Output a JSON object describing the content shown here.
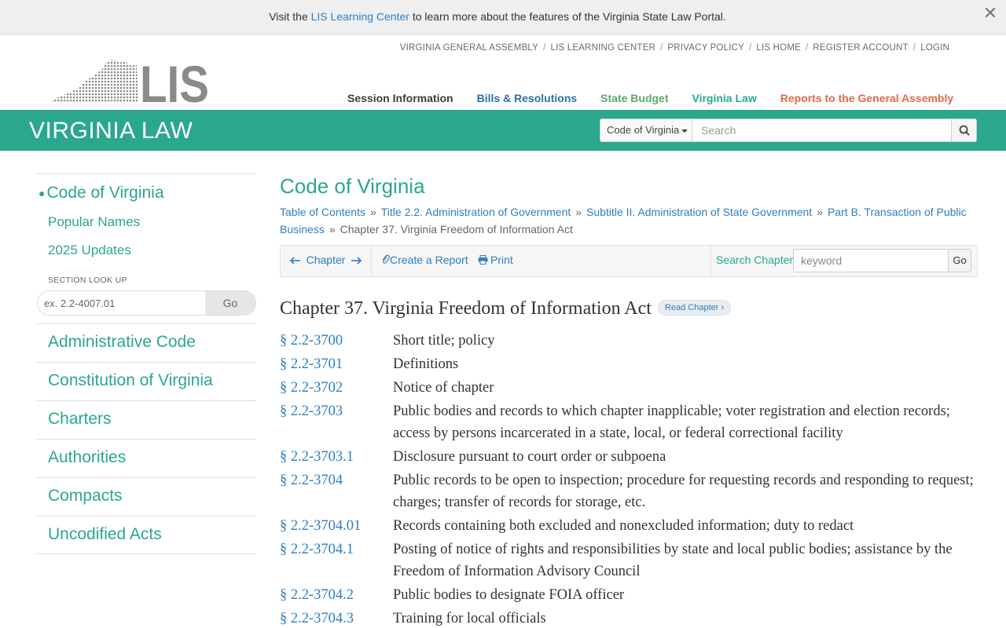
{
  "banner": {
    "prefix": "Visit the ",
    "link": "LIS Learning Center",
    "suffix": " to learn more about the features of the Virginia State Law Portal.",
    "close": "✕"
  },
  "top_links": [
    "VIRGINIA GENERAL ASSEMBLY",
    "LIS LEARNING CENTER",
    "PRIVACY POLICY",
    "LIS HOME",
    "REGISTER ACCOUNT",
    "LOGIN"
  ],
  "logo": {
    "text": "LIS"
  },
  "main_nav": {
    "session": "Session Information",
    "bills": "Bills & Resolutions",
    "budget": "State Budget",
    "law": "Virginia Law",
    "reports": "Reports to the General Assembly"
  },
  "greenbar": {
    "title": "VIRGINIA LAW",
    "select_value": "Code of Virginia",
    "search_placeholder": "Search"
  },
  "sidebar": {
    "current": "Code of Virginia",
    "sub_items": [
      "Popular Names",
      "2025 Updates"
    ],
    "lookup_label": "SECTION LOOK UP",
    "lookup_placeholder": "ex. 2.2-4007.01",
    "lookup_go": "Go",
    "main_items": [
      "Administrative Code",
      "Constitution of Virginia",
      "Charters",
      "Authorities",
      "Compacts",
      "Uncodified Acts"
    ]
  },
  "content": {
    "title": "Code of Virginia",
    "breadcrumb": {
      "links": [
        "Table of Contents",
        "Title 2.2. Administration of Government",
        "Subtitle II. Administration of State Government",
        "Part B. Transaction of Public Business"
      ],
      "current": "Chapter 37. Virginia Freedom of Information Act",
      "separator": "»"
    },
    "toolbar": {
      "chapter": "Chapter",
      "create_report": "Create a Report",
      "print": "Print",
      "search_label": "Search Chapter",
      "keyword_placeholder": "keyword",
      "go": "Go"
    },
    "chapter_heading": "Chapter 37. Virginia Freedom of Information Act",
    "read_chapter": "Read Chapter ›",
    "sections": [
      {
        "num": "§ 2.2-3700",
        "title": "Short title; policy"
      },
      {
        "num": "§ 2.2-3701",
        "title": "Definitions"
      },
      {
        "num": "§ 2.2-3702",
        "title": "Notice of chapter"
      },
      {
        "num": "§ 2.2-3703",
        "title": "Public bodies and records to which chapter inapplicable; voter registration and election records; access by persons incarcerated in a state, local, or federal correctional facility"
      },
      {
        "num": "§ 2.2-3703.1",
        "title": "Disclosure pursuant to court order or subpoena"
      },
      {
        "num": "§ 2.2-3704",
        "title": "Public records to be open to inspection; procedure for requesting records and responding to request; charges; transfer of records for storage, etc."
      },
      {
        "num": "§ 2.2-3704.01",
        "title": "Records containing both excluded and nonexcluded information; duty to redact"
      },
      {
        "num": "§ 2.2-3704.1",
        "title": "Posting of notice of rights and responsibilities by state and local public bodies; assistance by the Freedom of Information Advisory Council"
      },
      {
        "num": "§ 2.2-3704.2",
        "title": "Public bodies to designate FOIA officer"
      },
      {
        "num": "§ 2.2-3704.3",
        "title": "Training for local officials"
      }
    ]
  },
  "colors": {
    "brand_green": "#2ba78e",
    "link_blue": "#2f7ebf",
    "reports_orange": "#e06a48"
  }
}
